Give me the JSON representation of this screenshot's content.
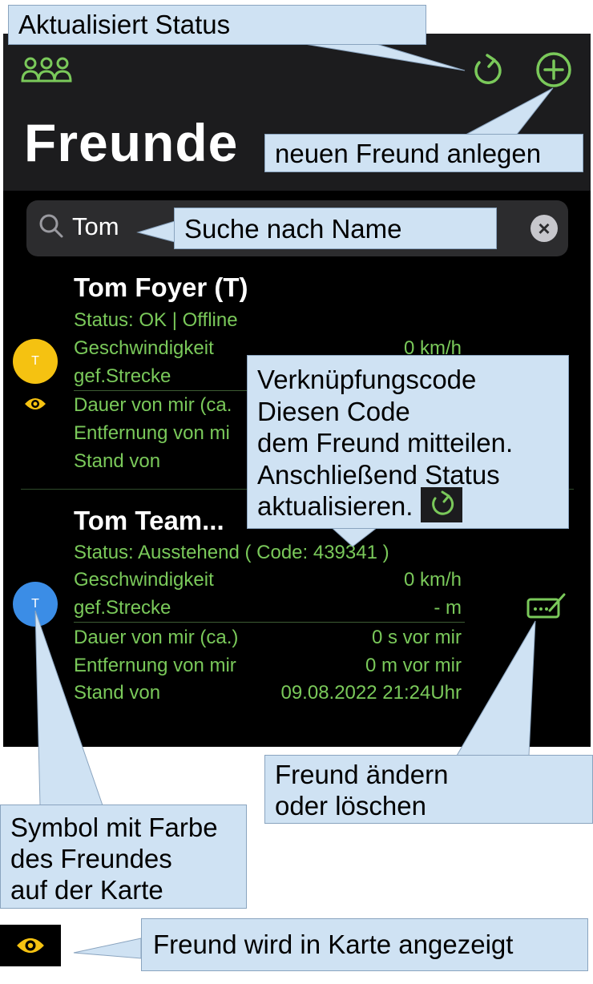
{
  "header": {
    "title": "Freunde",
    "group_icon": "people-group-icon",
    "refresh_icon": "refresh-icon",
    "add_icon": "add-circle-icon"
  },
  "search": {
    "value": "Tom",
    "icon": "search-icon",
    "clear_icon": "clear-icon"
  },
  "friends": [
    {
      "initial": "T",
      "avatar_color": "#f5c211",
      "name": "Tom Foyer (T)",
      "status": "Status: OK | Offline",
      "rows": [
        {
          "label": "Geschwindigkeit",
          "value": "0 km/h"
        },
        {
          "label": "gef.Strecke",
          "value": ""
        },
        {
          "label": "Dauer von mir (ca.",
          "value": ""
        },
        {
          "label": "Entfernung von mi",
          "value": ""
        },
        {
          "label": "Stand von",
          "value": ""
        }
      ]
    },
    {
      "initial": "T",
      "avatar_color": "#3b8de6",
      "name": "Tom Team...",
      "status": "Status: Ausstehend ( Code: 439341 )",
      "rows": [
        {
          "label": "Geschwindigkeit",
          "value": "0 km/h"
        },
        {
          "label": "gef.Strecke",
          "value": "- m"
        },
        {
          "label": "Dauer von mir (ca.)",
          "value": "0 s vor mir"
        },
        {
          "label": "Entfernung von mir",
          "value": "0 m vor mir"
        },
        {
          "label": "Stand von",
          "value": "09.08.2022 21:24Uhr"
        }
      ]
    }
  ],
  "callouts": {
    "refresh": "Aktualisiert Status",
    "add": "neuen Freund anlegen",
    "search": "Suche nach Name",
    "code_lines": [
      "Verknüpfungscode",
      "Diesen Code",
      "dem Freund mitteilen.",
      "Anschließend Status",
      "aktualisieren."
    ],
    "edit_lines": [
      "Freund ändern",
      "oder löschen"
    ],
    "symbol_lines": [
      "Symbol mit Farbe",
      "des Freundes",
      "auf der Karte"
    ],
    "visible": "Freund wird in Karte angezeigt"
  },
  "colors": {
    "accent": "#7ac95a",
    "callout": "#cfe2f3"
  }
}
